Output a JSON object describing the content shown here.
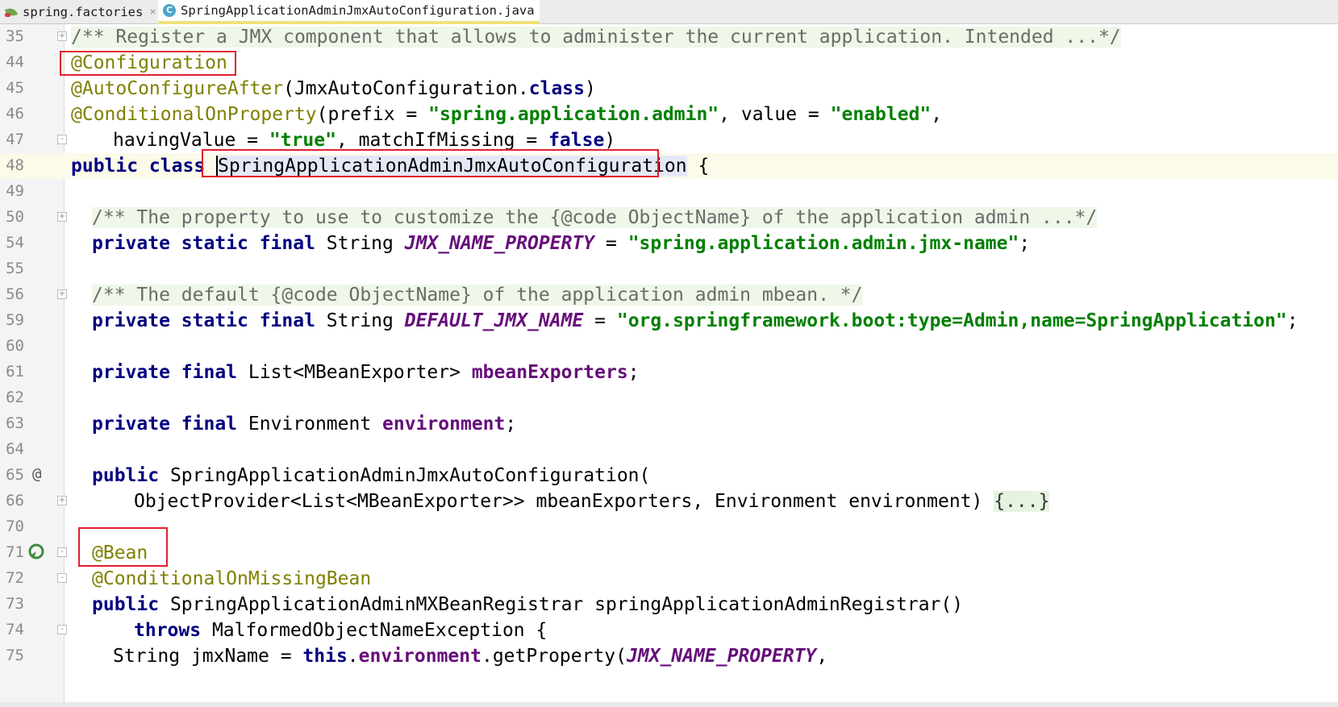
{
  "tabs": [
    {
      "label": "spring.factories",
      "icon": "spring-leaf-icon",
      "active": false
    },
    {
      "label": "SpringApplicationAdminJmxAutoConfiguration.java",
      "icon": "java-class-icon",
      "active": true
    }
  ],
  "close_glyph": "×",
  "line_numbers": [
    "35",
    "44",
    "45",
    "46",
    "47",
    "48",
    "49",
    "50",
    "54",
    "55",
    "56",
    "59",
    "60",
    "61",
    "62",
    "63",
    "64",
    "65",
    "66",
    "70",
    "71",
    "72",
    "73",
    "74",
    "75"
  ],
  "gutter_marks": {
    "at_symbol": "@"
  },
  "code": {
    "l35_comment": "/** Register a JMX component that allows to administer the current application. Intended ...*/",
    "l44_ann": "@Configuration",
    "l45_ann": "@AutoConfigureAfter",
    "l45_rest_a": "(JmxAutoConfiguration.",
    "l45_kw": "class",
    "l45_rest_b": ")",
    "l46_ann": "@ConditionalOnProperty",
    "l46_a": "(prefix = ",
    "l46_str1": "\"spring.application.admin\"",
    "l46_b": ", value = ",
    "l46_str2": "\"enabled\"",
    "l46_c": ",",
    "l47_a": "havingValue = ",
    "l47_str": "\"true\"",
    "l47_b": ", matchIfMissing = ",
    "l47_kw": "false",
    "l47_c": ")",
    "l48_kw": "public class ",
    "l48_name": "SpringApplicationAdminJmxAutoConfiguration",
    "l48_rest": " {",
    "l50_comment": "/** The property to use to customize the {@code ObjectName} of the application admin ...*/",
    "l54_kw": "private static final ",
    "l54_type": "String ",
    "l54_field": "JMX_NAME_PROPERTY",
    "l54_eq": " = ",
    "l54_str": "\"spring.application.admin.jmx-name\"",
    "l54_end": ";",
    "l56_comment": "/** The default {@code ObjectName} of the application admin mbean. */",
    "l59_kw": "private static final ",
    "l59_type": "String ",
    "l59_field": "DEFAULT_JMX_NAME",
    "l59_eq": " = ",
    "l59_str": "\"org.springframework.boot:type=Admin,name=SpringApplication\"",
    "l59_end": ";",
    "l61_kw": "private final ",
    "l61_type": "List<MBeanExporter> ",
    "l61_field": "mbeanExporters",
    "l61_end": ";",
    "l63_kw": "private final ",
    "l63_type": "Environment ",
    "l63_field": "environment",
    "l63_end": ";",
    "l65_kw": "public ",
    "l65_rest": "SpringApplicationAdminJmxAutoConfiguration(",
    "l66_a": "ObjectProvider<List<MBeanExporter>> mbeanExporters, Environment environment) ",
    "l66_fold": "{...}",
    "l71_ann": "@Bean",
    "l72_ann": "@ConditionalOnMissingBean",
    "l73_kw": "public ",
    "l73_rest": "SpringApplicationAdminMXBeanRegistrar springApplicationAdminRegistrar()",
    "l74_kw": "throws ",
    "l74_rest": "MalformedObjectNameException {",
    "l75_a": "String jmxName = ",
    "l75_kw": "this",
    "l75_b": ".",
    "l75_field": "environment",
    "l75_c": ".getProperty(",
    "l75_sfield": "JMX_NAME_PROPERTY",
    "l75_d": ","
  },
  "colors": {
    "annotation_box": "#e0202e",
    "keyword": "#000080",
    "string": "#008000",
    "annotation": "#808000",
    "field": "#660e7a"
  }
}
